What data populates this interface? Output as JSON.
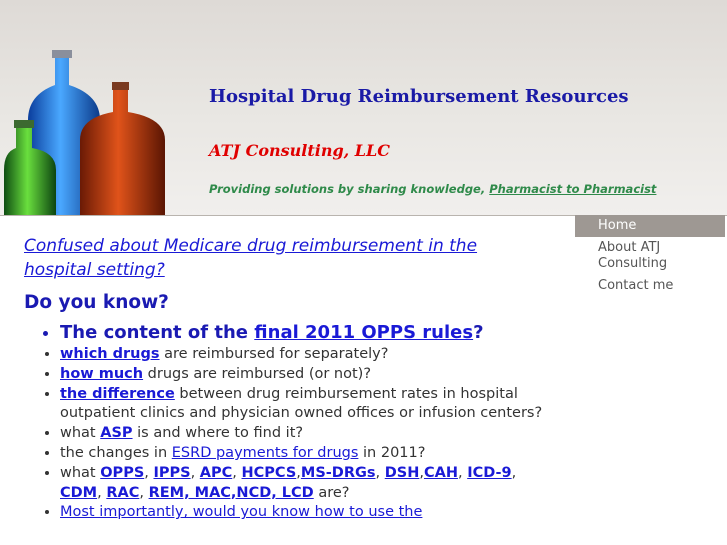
{
  "header": {
    "site_title": "Hospital Drug Reimbursement Resources",
    "company": "ATJ Consulting, LLC",
    "tagline_prefix": "Providing solutions by sharing knowledge, ",
    "tagline_link": "Pharmacist to Pharmacist"
  },
  "nav": {
    "items": [
      {
        "label": "Home"
      },
      {
        "label": "About ATJ Consulting"
      },
      {
        "label": "Contact me"
      }
    ]
  },
  "main": {
    "intro_link": "Confused about Medicare drug reimbursement in the hospital setting?",
    "heading": "Do you know?",
    "items": [
      {
        "pre": "The content of the ",
        "link": "final 2011 OPPS rules",
        "post": "?"
      },
      {
        "link": "which drugs",
        "post": " are reimbursed for separately?"
      },
      {
        "link": "how much",
        "post": " drugs are reimbursed (or not)?"
      },
      {
        "link": "the difference",
        "post": " between drug reimbursement rates in hospital outpatient clinics and physician owned offices or infusion centers?"
      },
      {
        "pre": "what ",
        "link": "ASP",
        "post": " is and where to find it?"
      },
      {
        "pre": "the changes in ",
        "link": "ESRD payments for drugs",
        "post": " in 2011?"
      },
      {
        "pre": "what ",
        "links": [
          "OPPS",
          "IPPS",
          "APC",
          "HCPCS",
          "MS-DRGs",
          "DSH",
          "CAH",
          "ICD-9",
          "CDM",
          "RAC",
          "REM, MAC,NCD, LCD"
        ],
        "seps": [
          ", ",
          ", ",
          ", ",
          ",",
          ", ",
          ",",
          ", ",
          ", ",
          ", ",
          ", "
        ],
        "post": " are?"
      },
      {
        "pre": "Most importantly, would you know how to use the"
      }
    ]
  },
  "colors": {
    "title_blue": "#1a1aa6",
    "company_red": "#e00000",
    "tagline_green": "#2f8a4a",
    "link_blue": "#1a1ad6",
    "nav_active_bg": "#9e9893"
  }
}
